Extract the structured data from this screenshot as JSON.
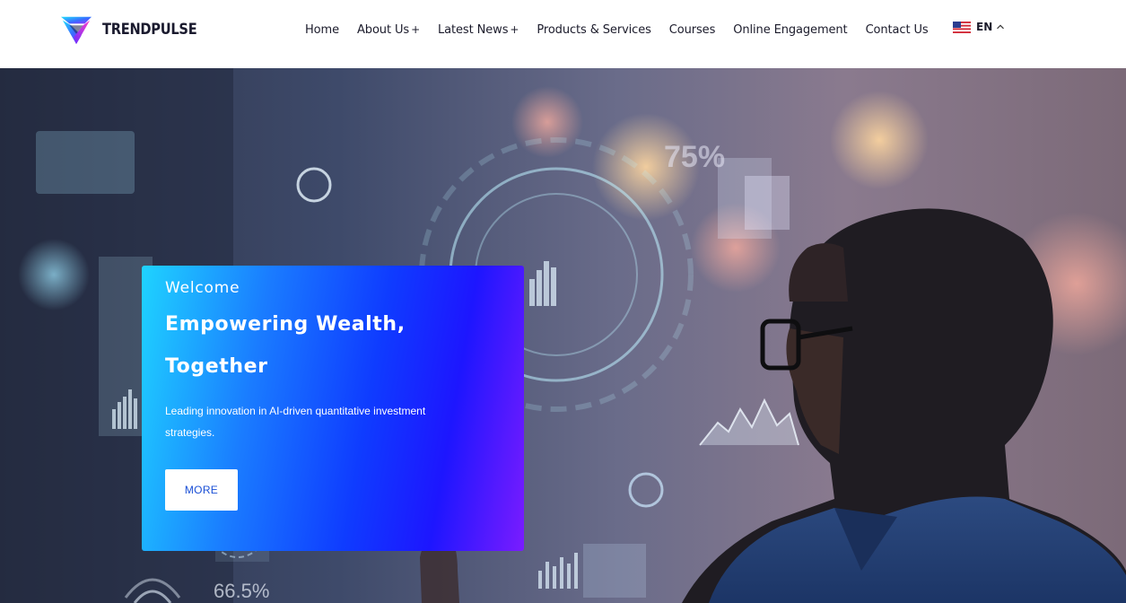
{
  "brand": {
    "name": "TRENDPULSE",
    "logo_icon": "trendpulse-logo-icon"
  },
  "nav": {
    "items": [
      {
        "label": "Home",
        "has_submenu": false
      },
      {
        "label": "About Us",
        "has_submenu": true
      },
      {
        "label": "Latest News",
        "has_submenu": true
      },
      {
        "label": "Products & Services",
        "has_submenu": false
      },
      {
        "label": "Courses",
        "has_submenu": false
      },
      {
        "label": "Online Engagement",
        "has_submenu": false
      },
      {
        "label": "Contact Us",
        "has_submenu": false
      }
    ]
  },
  "language": {
    "label": "EN",
    "flag_icon": "us-flag-icon",
    "caret_icon": "chevron-up-icon"
  },
  "hero": {
    "overlay_texts": {
      "percent_top": "75%",
      "percent_bottom": "66.5%"
    },
    "card": {
      "welcome": "Welcome",
      "title_line1": "Empowering Wealth,",
      "title_line2": "Together",
      "description": "Leading innovation in AI-driven quantitative investment strategies.",
      "button_label": "MORE"
    }
  },
  "colors": {
    "card_gradient_start": "#1fd3ff",
    "card_gradient_mid": "#0f3cff",
    "card_gradient_end": "#7a1cff",
    "button_text": "#1a4fd6",
    "nav_text": "#1b1b2b"
  }
}
